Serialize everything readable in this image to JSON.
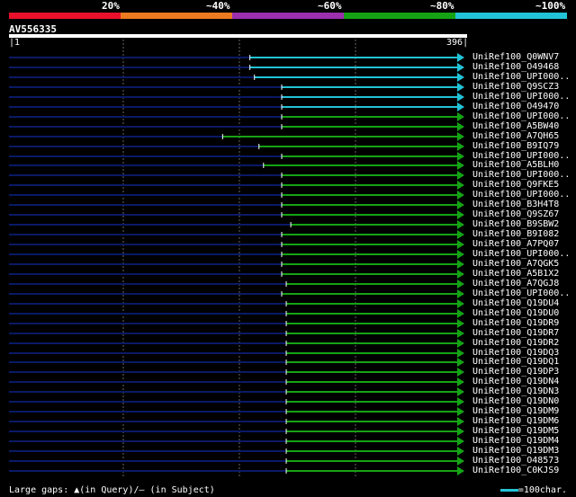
{
  "header": {
    "percent_labels": [
      "20%",
      "~40%",
      "~60%",
      "~80%",
      "~100%"
    ],
    "colors": [
      "#e8112b",
      "#ec7a20",
      "#9b2fae",
      "#15a315",
      "#22c3d6"
    ]
  },
  "query": {
    "id": "AV556335",
    "start": "1",
    "end": "396"
  },
  "hits": [
    {
      "label": "UniRef100_Q0WNV7",
      "start": 0.53,
      "color": "#22c3d6"
    },
    {
      "label": "UniRef100_O49468",
      "start": 0.53,
      "color": "#22c3d6"
    },
    {
      "label": "UniRef100_UPI000..",
      "start": 0.54,
      "color": "#22c3d6"
    },
    {
      "label": "UniRef100_Q9SCZ3",
      "start": 0.6,
      "color": "#22c3d6"
    },
    {
      "label": "UniRef100_UPI000..",
      "start": 0.6,
      "color": "#22c3d6"
    },
    {
      "label": "UniRef100_O49470",
      "start": 0.6,
      "color": "#22c3d6"
    },
    {
      "label": "UniRef100_UPI000..",
      "start": 0.6,
      "color": "#15a315"
    },
    {
      "label": "UniRef100_A5BW40",
      "start": 0.6,
      "color": "#15a315"
    },
    {
      "label": "UniRef100_A7QH65",
      "start": 0.47,
      "color": "#15a315"
    },
    {
      "label": "UniRef100_B9IQ79",
      "start": 0.55,
      "color": "#15a315"
    },
    {
      "label": "UniRef100_UPI000..",
      "start": 0.6,
      "color": "#15a315"
    },
    {
      "label": "UniRef100_A5BLH0",
      "start": 0.56,
      "color": "#15a315"
    },
    {
      "label": "UniRef100_UPI000..",
      "start": 0.6,
      "color": "#15a315"
    },
    {
      "label": "UniRef100_Q9FKE5",
      "start": 0.6,
      "color": "#15a315"
    },
    {
      "label": "UniRef100_UPI000..",
      "start": 0.6,
      "color": "#15a315"
    },
    {
      "label": "UniRef100_B3H4T8",
      "start": 0.6,
      "color": "#15a315"
    },
    {
      "label": "UniRef100_Q9SZ67",
      "start": 0.6,
      "color": "#15a315"
    },
    {
      "label": "UniRef100_B9SBW2",
      "start": 0.62,
      "color": "#15a315"
    },
    {
      "label": "UniRef100_B9I082",
      "start": 0.6,
      "color": "#15a315"
    },
    {
      "label": "UniRef100_A7PQ07",
      "start": 0.6,
      "color": "#15a315"
    },
    {
      "label": "UniRef100_UPI000..",
      "start": 0.6,
      "color": "#15a315"
    },
    {
      "label": "UniRef100_A7QGK5",
      "start": 0.6,
      "color": "#15a315"
    },
    {
      "label": "UniRef100_A5B1X2",
      "start": 0.6,
      "color": "#15a315"
    },
    {
      "label": "UniRef100_A7QGJ8",
      "start": 0.61,
      "color": "#15a315"
    },
    {
      "label": "UniRef100_UPI000..",
      "start": 0.6,
      "color": "#15a315"
    },
    {
      "label": "UniRef100_Q19DU4",
      "start": 0.61,
      "color": "#15a315"
    },
    {
      "label": "UniRef100_Q19DU0",
      "start": 0.61,
      "color": "#15a315"
    },
    {
      "label": "UniRef100_Q19DR9",
      "start": 0.61,
      "color": "#15a315"
    },
    {
      "label": "UniRef100_Q19DR7",
      "start": 0.61,
      "color": "#15a315"
    },
    {
      "label": "UniRef100_Q19DR2",
      "start": 0.61,
      "color": "#15a315"
    },
    {
      "label": "UniRef100_Q19DQ3",
      "start": 0.61,
      "color": "#15a315"
    },
    {
      "label": "UniRef100_Q19DQ1",
      "start": 0.61,
      "color": "#15a315"
    },
    {
      "label": "UniRef100_Q19DP3",
      "start": 0.61,
      "color": "#15a315"
    },
    {
      "label": "UniRef100_Q19DN4",
      "start": 0.61,
      "color": "#15a315"
    },
    {
      "label": "UniRef100_Q19DN3",
      "start": 0.61,
      "color": "#15a315"
    },
    {
      "label": "UniRef100_Q19DN0",
      "start": 0.61,
      "color": "#15a315"
    },
    {
      "label": "UniRef100_Q19DM9",
      "start": 0.61,
      "color": "#15a315"
    },
    {
      "label": "UniRef100_Q19DM6",
      "start": 0.61,
      "color": "#15a315"
    },
    {
      "label": "UniRef100_Q19DM5",
      "start": 0.61,
      "color": "#15a315"
    },
    {
      "label": "UniRef100_Q19DM4",
      "start": 0.61,
      "color": "#15a315"
    },
    {
      "label": "UniRef100_Q19DM3",
      "start": 0.61,
      "color": "#15a315"
    },
    {
      "label": "UniRef100_O48573",
      "start": 0.61,
      "color": "#15a315"
    },
    {
      "label": "UniRef100_C0KJS9",
      "start": 0.61,
      "color": "#15a315"
    }
  ],
  "footer": {
    "gaps_text": "Large gaps: ▲(in Query)/– (in Subject)",
    "legend_text": "=100char."
  }
}
